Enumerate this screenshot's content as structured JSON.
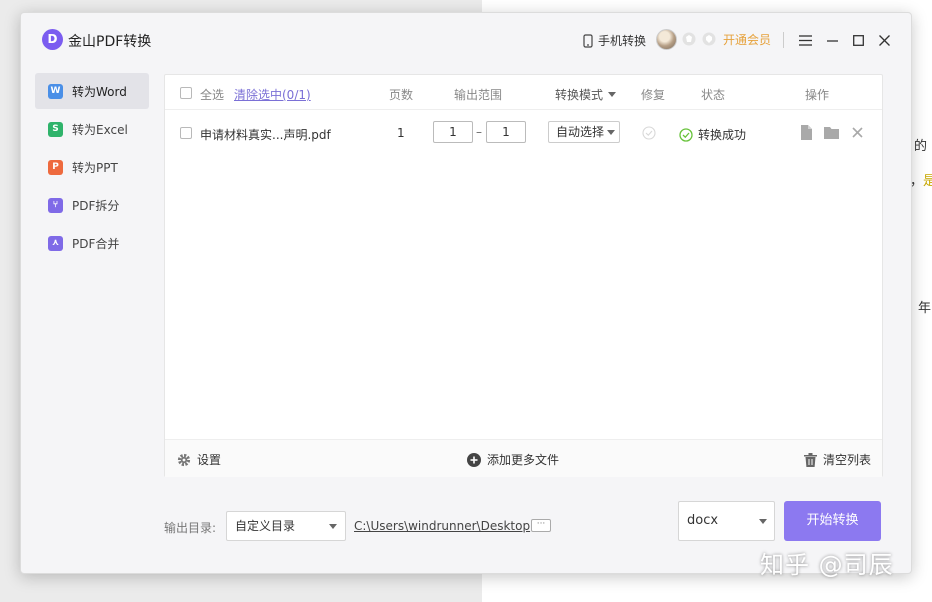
{
  "app": {
    "logo_letter": "D",
    "title": "金山PDF转换",
    "mobile_convert": "手机转换",
    "vip_label": "开通会员",
    "accent_color": "#7b5cf0"
  },
  "sidebar": {
    "items": [
      {
        "label": "转为Word",
        "icon": "word-icon",
        "icon_char": "W",
        "active": true
      },
      {
        "label": "转为Excel",
        "icon": "excel-icon",
        "icon_char": "S",
        "active": false
      },
      {
        "label": "转为PPT",
        "icon": "ppt-icon",
        "icon_char": "P",
        "active": false
      },
      {
        "label": "PDF拆分",
        "icon": "split-icon",
        "icon_char": "⑂",
        "active": false
      },
      {
        "label": "PDF合并",
        "icon": "merge-icon",
        "icon_char": "⋏",
        "active": false
      }
    ]
  },
  "table": {
    "select_all": "全选",
    "clear_selected": "清除选中(0/1)",
    "columns": {
      "pages": "页数",
      "range": "输出范围",
      "mode": "转换模式",
      "repair": "修复",
      "status": "状态",
      "actions": "操作"
    },
    "rows": [
      {
        "filename": "申请材料真实...声明.pdf",
        "pages": "1",
        "range_from": "1",
        "range_to": "1",
        "mode": "自动选择",
        "status": "转换成功",
        "status_color": "#67c23a"
      }
    ]
  },
  "panel_footer": {
    "settings": "设置",
    "add_files": "添加更多文件",
    "clear_list": "清空列表"
  },
  "output": {
    "label": "输出目录:",
    "dir_option": "自定义目录",
    "path": "C:\\Users\\windrunner\\Desktop",
    "more": "···",
    "format": "docx",
    "start_button": "开始转换"
  },
  "background": {
    "text1": "的",
    "text2_prefix": "，",
    "text2_accent": "是",
    "text3": "年",
    "watermark": "知乎 @司辰"
  }
}
